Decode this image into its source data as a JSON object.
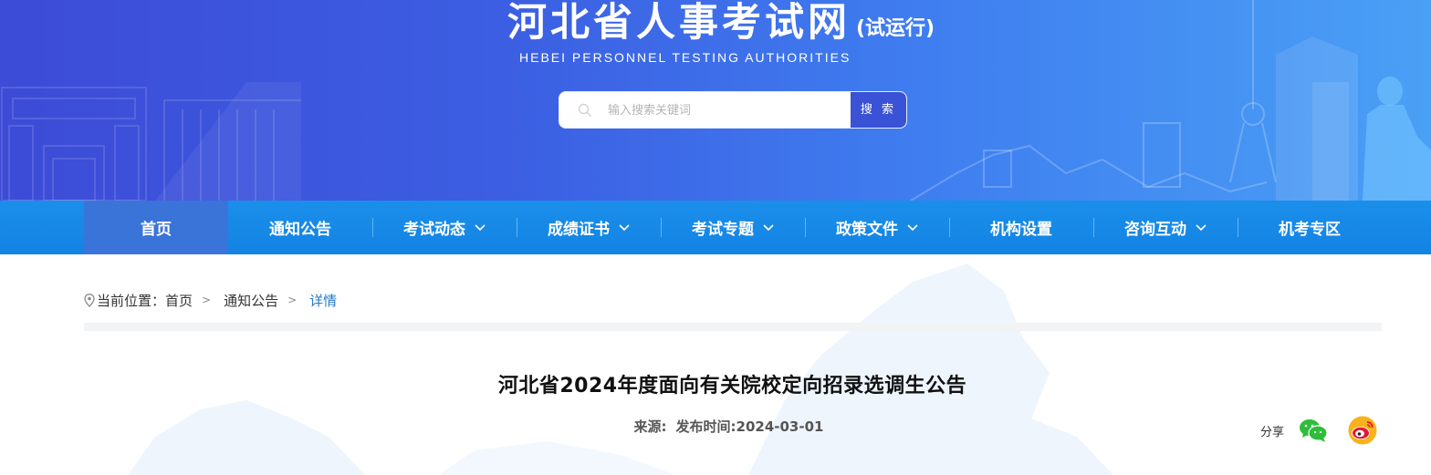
{
  "header": {
    "site_title": "河北省人事考试网",
    "site_title_suffix": "(试运行)",
    "site_subtitle": "HEBEI  PERSONNEL  TESTING  AUTHORITIES",
    "search": {
      "placeholder": "输入搜索关键词",
      "value": "",
      "button_label": "搜 索",
      "icon": "search-icon"
    },
    "colors": {
      "banner_start": "#3d4bd6",
      "banner_end": "#4aa0f5"
    }
  },
  "nav": {
    "items": [
      {
        "label": "首页",
        "active": true,
        "has_dropdown": false
      },
      {
        "label": "通知公告",
        "active": false,
        "has_dropdown": false
      },
      {
        "label": "考试动态",
        "active": false,
        "has_dropdown": true
      },
      {
        "label": "成绩证书",
        "active": false,
        "has_dropdown": true
      },
      {
        "label": "考试专题",
        "active": false,
        "has_dropdown": true
      },
      {
        "label": "政策文件",
        "active": false,
        "has_dropdown": true
      },
      {
        "label": "机构设置",
        "active": false,
        "has_dropdown": false
      },
      {
        "label": "咨询互动",
        "active": false,
        "has_dropdown": true
      },
      {
        "label": "机考专区",
        "active": false,
        "has_dropdown": false
      }
    ],
    "colors": {
      "bar": "#1a8fea",
      "active": "#3a74d8"
    }
  },
  "breadcrumb": {
    "prefix": "当前位置：",
    "home": "首页",
    "section": "通知公告",
    "current": "详情",
    "separator": ">",
    "icon": "location-pin-icon"
  },
  "article": {
    "title": "河北省2024年度面向有关院校定向招录选调生公告",
    "source_label": "来源:",
    "publish_label": "发布时间:2024-03-01"
  },
  "share": {
    "label": "分享",
    "icons": [
      "wechat-icon",
      "weibo-icon"
    ]
  }
}
